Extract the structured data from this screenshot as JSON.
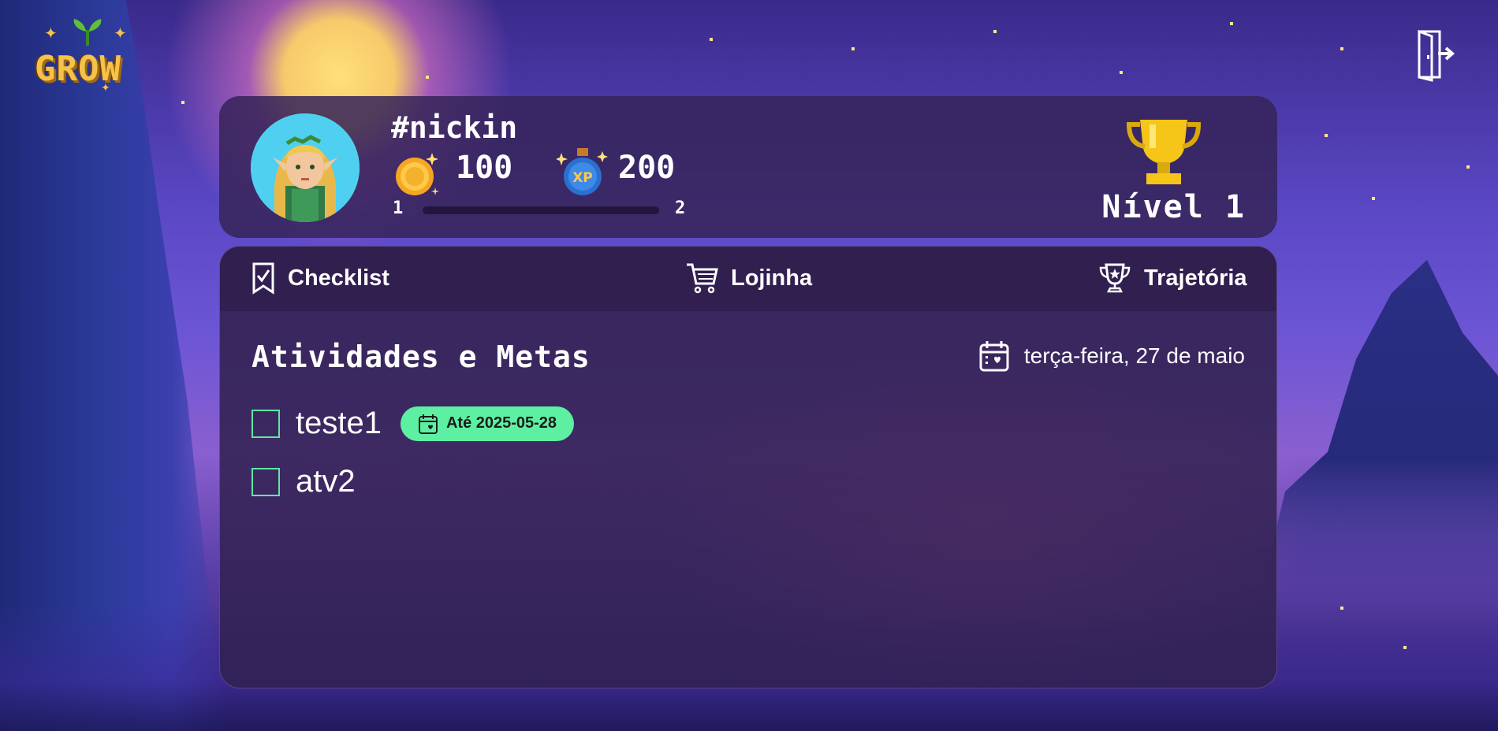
{
  "app": {
    "logo_text": "GROW"
  },
  "profile": {
    "username": "#nickin",
    "coins": "100",
    "xp": "200",
    "level_start": "1",
    "level_end": "2",
    "level_progress": 0,
    "level_label": "Nível 1"
  },
  "tabs": [
    {
      "label": "Checklist",
      "icon": "bookmark-check-icon"
    },
    {
      "label": "Lojinha",
      "icon": "cart-icon"
    },
    {
      "label": "Trajetória",
      "icon": "trophy-star-icon"
    }
  ],
  "main": {
    "title": "Atividades e Metas",
    "date": "terça-feira, 27 de maio"
  },
  "tasks": [
    {
      "label": "teste1",
      "due": "Até 2025-05-28",
      "checked": false
    },
    {
      "label": "atv2",
      "checked": false
    }
  ],
  "colors": {
    "accent": "#5df0a2",
    "card": "#362458",
    "gold": "#f5c24a"
  }
}
